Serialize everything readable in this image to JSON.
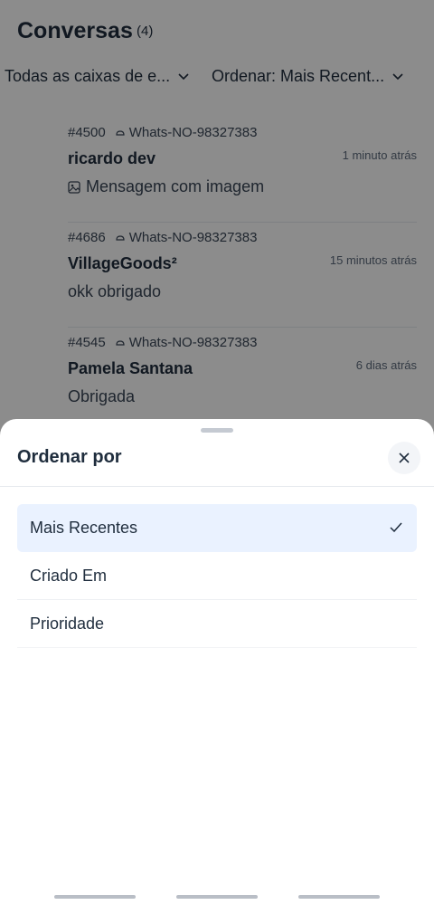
{
  "header": {
    "title": "Conversas",
    "count": "(4)"
  },
  "filters": {
    "inbox_label": "Todas as caixas de e...",
    "sort_label": "Ordenar: Mais Recent..."
  },
  "conversations": [
    {
      "id": "#4500",
      "inbox": "Whats-NO-98327383",
      "name": "ricardo dev",
      "time": "1 minuto atrás",
      "message": "Mensagem com imagem",
      "icon": "image-icon"
    },
    {
      "id": "#4686",
      "inbox": "Whats-NO-98327383",
      "name": "VillageGoods²",
      "time": "15 minutos atrás",
      "message": "okk obrigado"
    },
    {
      "id": "#4545",
      "inbox": "Whats-NO-98327383",
      "name": "Pamela Santana",
      "time": "6 dias atrás",
      "message": "Obrigada"
    }
  ],
  "sort_sheet": {
    "title": "Ordenar por",
    "options": [
      {
        "label": "Mais Recentes",
        "selected": true
      },
      {
        "label": "Criado Em",
        "selected": false
      },
      {
        "label": "Prioridade",
        "selected": false
      }
    ]
  },
  "colors": {
    "selected_bg": "#eaf2ff",
    "text_primary": "#1f2d3d",
    "overlay": "rgba(0,0,0,0.45)"
  }
}
